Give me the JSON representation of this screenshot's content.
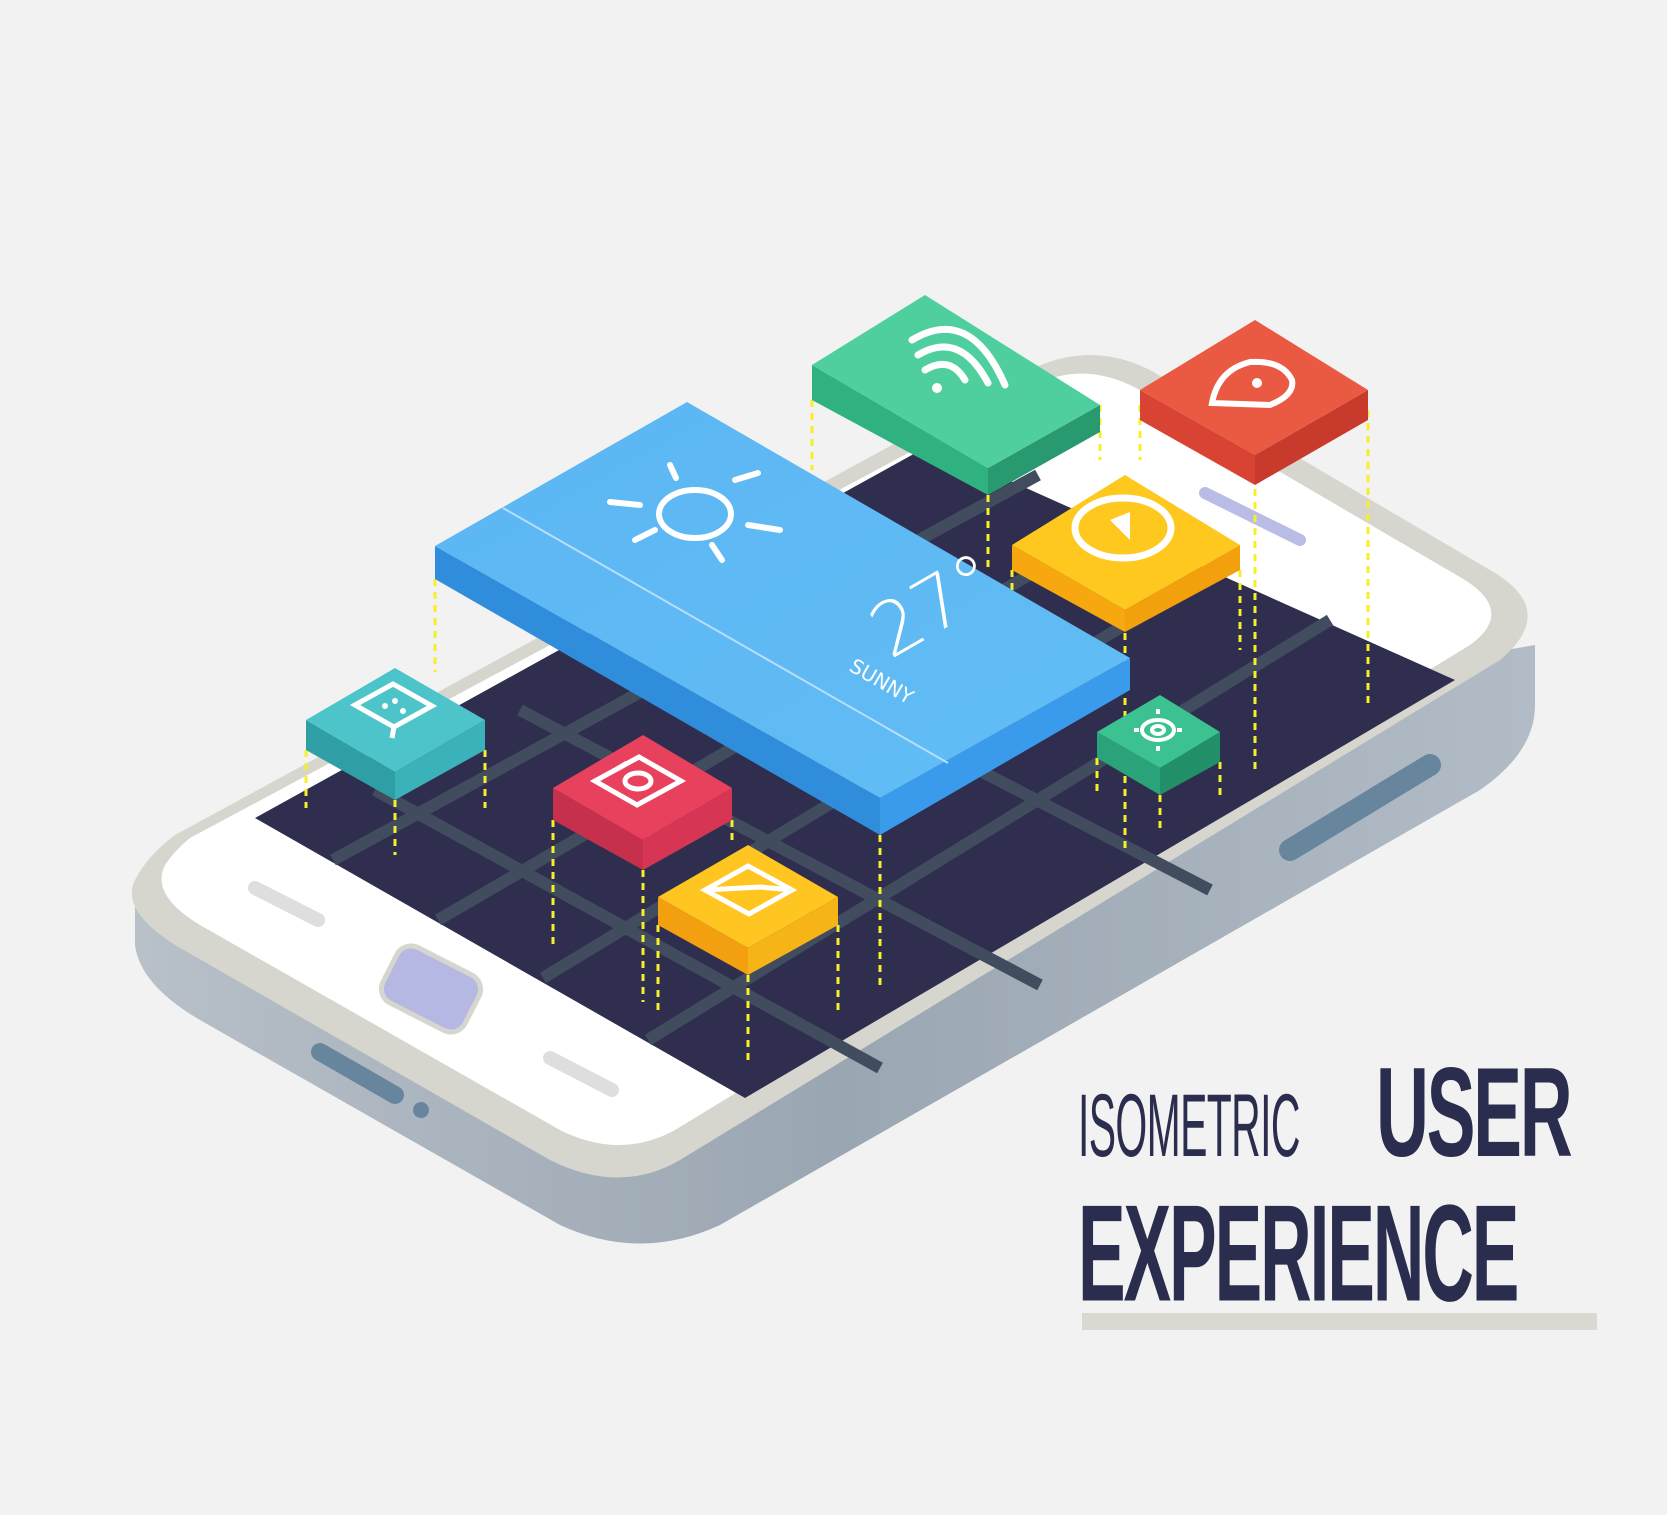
{
  "headline": {
    "prefix": "ISOMETRIC",
    "emphasis": "USER",
    "second_line": "EXPERIENCE"
  },
  "weather_tile": {
    "temperature": "27°",
    "condition": "SUNNY",
    "icon": "sun-icon"
  },
  "app_tiles": [
    {
      "icon": "wifi-icon",
      "color": "#4fcf9d"
    },
    {
      "icon": "location-pin-icon",
      "color": "#ea5a43"
    },
    {
      "icon": "play-icon",
      "color": "#ffc81e"
    },
    {
      "icon": "chat-icon",
      "color": "#4dc4c9"
    },
    {
      "icon": "camera-icon",
      "color": "#e8415d"
    },
    {
      "icon": "mail-icon",
      "color": "#ffc520"
    },
    {
      "icon": "gear-icon",
      "color": "#3cc291"
    }
  ],
  "colors": {
    "background": "#f2f2f2",
    "screen": "#2f2e4f",
    "weather": "#4bb0f0",
    "guide_lines": "#f7ef2a",
    "headline": "#2b2d4e"
  }
}
